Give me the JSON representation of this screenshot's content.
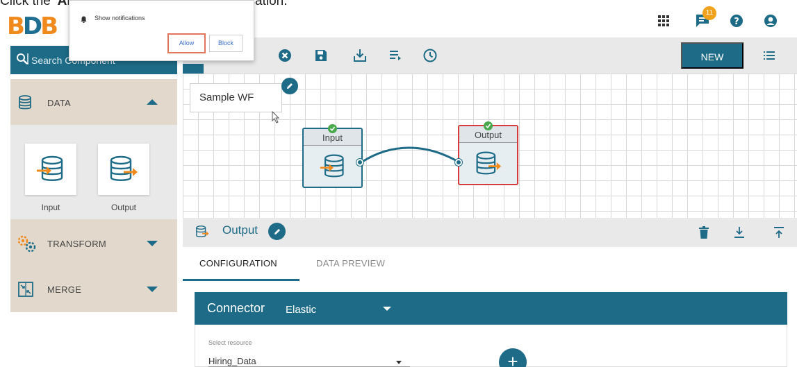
{
  "caption": {
    "prefix": "Click the ",
    "bold": "'Allow'",
    "suffix": " option to display the notification."
  },
  "logo": {
    "text_left": "B",
    "text_mid": "D",
    "text_right": "B"
  },
  "header": {
    "notification_count": "11"
  },
  "notification_popup": {
    "message": "Show notifications",
    "allow_label": "Allow",
    "block_label": "Block"
  },
  "search": {
    "placeholder": "Search Component"
  },
  "sidebar": {
    "sections": [
      {
        "label": "DATA",
        "icon": "database-icon",
        "expanded": true
      },
      {
        "label": "TRANSFORM",
        "icon": "gears-icon",
        "expanded": false
      },
      {
        "label": "MERGE",
        "icon": "merge-icon",
        "expanded": false
      }
    ],
    "components": [
      {
        "label": "Input",
        "icon": "database-input-icon"
      },
      {
        "label": "Output",
        "icon": "database-output-icon"
      }
    ]
  },
  "toolbar": {
    "new_label": "NEW"
  },
  "workflow": {
    "name": "Sample WF",
    "nodes": [
      {
        "title": "Input",
        "status": "success",
        "selected": false
      },
      {
        "title": "Output",
        "status": "success",
        "selected": true
      }
    ]
  },
  "panel": {
    "title": "Output",
    "tabs": [
      {
        "label": "CONFIGURATION",
        "active": true
      },
      {
        "label": "DATA PREVIEW",
        "active": false
      }
    ],
    "connector": {
      "label": "Connector",
      "value": "Elastic"
    },
    "resource": {
      "label": "Select resource",
      "value": "Hiring_Data"
    }
  },
  "colors": {
    "primary": "#1d6b86",
    "accent": "#f08a1c",
    "selected_border": "#d63a3a",
    "badge": "#f0a21a"
  }
}
